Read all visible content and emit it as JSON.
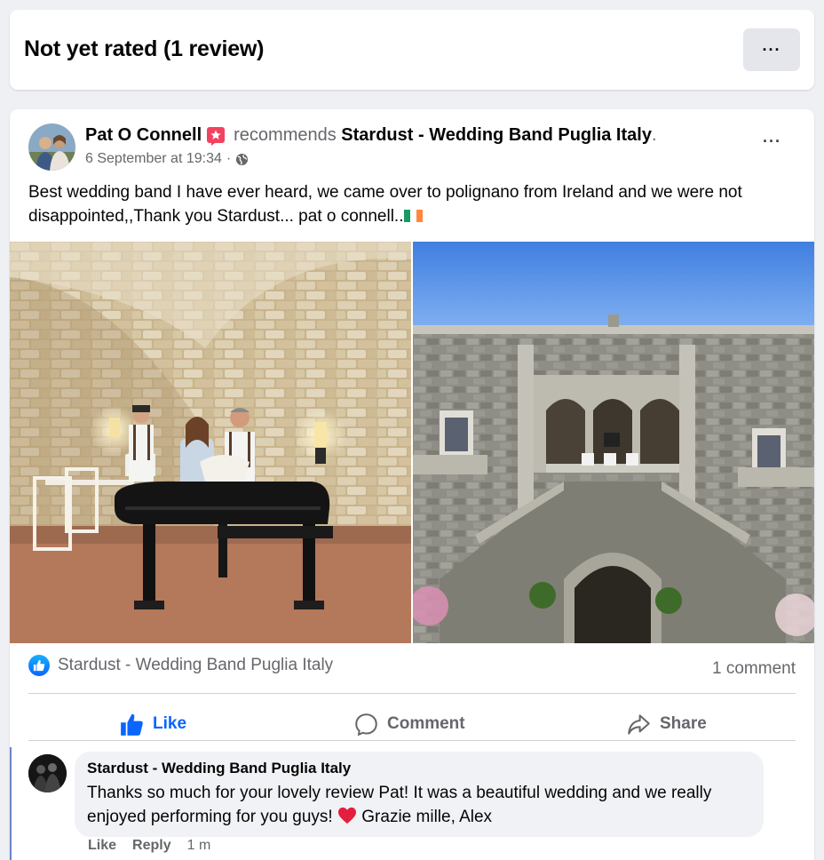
{
  "rating": {
    "title": "Not yet rated (1 review)",
    "more_label": "···"
  },
  "post": {
    "author": "Pat O Connell",
    "badge_icon": "recommend-star-badge-icon",
    "recommends_word": "recommends",
    "page_name": "Stardust - Wedding Band Puglia Italy",
    "period": ".",
    "timestamp": "6 September at 19:34",
    "separator": "·",
    "privacy_icon": "globe-icon",
    "more_label": "···",
    "text_main": "Best wedding band I have ever heard, we came over to polignano from Ireland and we were not disappointed,,Thank you Stardust...  pat o connell..",
    "flag_icon": "ireland-flag-icon",
    "photos": [
      {
        "name": "photo-band-at-piano"
      },
      {
        "name": "photo-castle-facade"
      }
    ],
    "reaction_name": "Stardust - Wedding Band Puglia Italy",
    "comment_count": "1 comment"
  },
  "actions": {
    "like": "Like",
    "comment": "Comment",
    "share": "Share"
  },
  "comment": {
    "author": "Stardust - Wedding Band Puglia Italy",
    "text_main": "Thanks so much for your lovely review Pat! It was a beautiful wedding and we really enjoyed performing for you guys! ",
    "text_after_heart": " Grazie mille, Alex",
    "like": "Like",
    "reply": "Reply",
    "time": "1 m"
  },
  "colors": {
    "brand_blue": "#0866ff",
    "muted_text": "#65676b",
    "bubble_bg": "#f0f2f5",
    "heart_red": "#e41e3f"
  }
}
